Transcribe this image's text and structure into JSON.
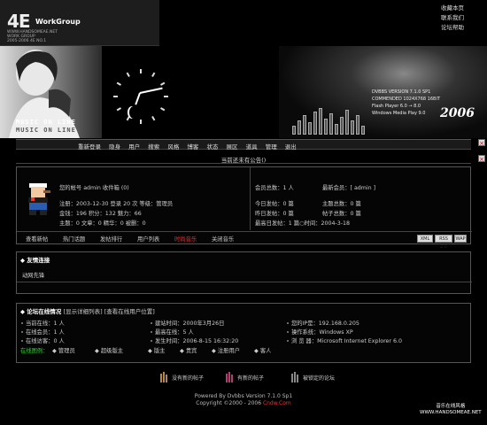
{
  "banner": {
    "logo": "4E",
    "logo_sub": "WorkGroup",
    "logo_lines": [
      "WWW.HANDSOMEAE.NET",
      "WORK GROUP",
      "2005-2006 4E NO.1"
    ],
    "music_line": "MUSIC ON LINE",
    "music_line_reflect": "MUSIC ON LINE",
    "stage_lines": [
      "DVBBS VERSION 7.1.0 SP1",
      "COMMENDED 1024X768 16BIT",
      "Flash Player 6.0 → 8.0",
      "Windows Media Play 9.0"
    ],
    "year": "2006",
    "top_links": [
      "收藏本页",
      "联系我们",
      "论坛帮助"
    ]
  },
  "menu": {
    "items": [
      "重新登录",
      "隐身",
      "用户",
      "搜索",
      "风格",
      "博客",
      "状态",
      "展区",
      "道具",
      "管理",
      "退出"
    ],
    "side_close": "×"
  },
  "notice": "当前还未有公告()",
  "user": {
    "account": "您的帐号 admin 收件箱 (0)",
    "line1": "注册：2003-12-30 登录 20 次 等级：管理员",
    "line2": "金钱：196 积分：132 魅力：66",
    "line3": "主题：0 文章：0 精华：0 被删：0",
    "members": "会员总数：1 人",
    "newest": "最新会员：[ admin ]",
    "today": "今日发帖：0 篇",
    "topics": "主题总数：0 篇",
    "yesterday": "昨日发帖：0 篇",
    "posts": "帖子总数：0 篇",
    "max": "最高日发帖：1 篇○时间：2004-3-18"
  },
  "panel_links": [
    "查看新帖",
    "热门话题",
    "发帖排行",
    "用户列表",
    "时尚音乐",
    "关闭音乐"
  ],
  "panel_buttons": [
    "XML",
    "RSS 2.0",
    "WAP"
  ],
  "links_box": {
    "title": "友情连接",
    "item": "动网先锋"
  },
  "online": {
    "title": "论坛在线情况",
    "title_links": "[显示详细列表] [查看在线用户位置]",
    "col1": [
      "当前在线：1 人",
      "在线会员：1 人",
      "在线访客：0 人"
    ],
    "col2": [
      "建站时间：2000年3月26日",
      "最高在线：5 人",
      "发生时间：2006-8-15 16:32:20"
    ],
    "col3": [
      "您的IP是：192.168.0.205",
      "操作系统：Windows XP",
      "浏 览 器：Microsoft Internet Explorer 6.0"
    ],
    "legend_label": "在线图例：",
    "legend": [
      "管理员",
      "超级版主",
      "版主",
      "贵宾",
      "注册用户",
      "客人"
    ]
  },
  "bottom_icons": [
    "没有新的帖子",
    "有新的帖子",
    "被锁定的论坛"
  ],
  "footer": {
    "line1": "Powered By Dvbbs Version 7.1.0 Sp1",
    "line2_pre": "Copyright ©2000 - 2006 ",
    "line2_brand": "Cndw.Com"
  },
  "footer_right": {
    "line1": "音乐在线风格",
    "line2": "WWW.HANDSOMEAE.NET"
  },
  "colors": {
    "accent_red": "#e33",
    "bg": "#000000",
    "border": "#555555"
  }
}
